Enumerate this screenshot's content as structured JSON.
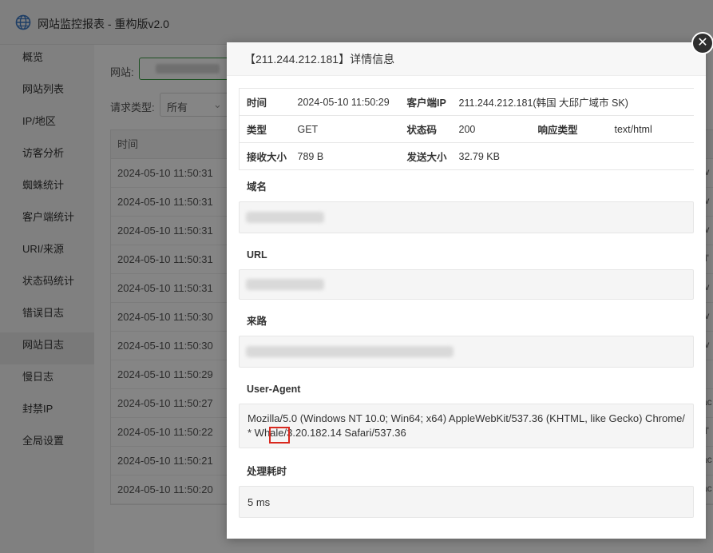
{
  "window": {
    "title": "网站监控报表 - 重构版v2.0",
    "logo_icon": "globe-icon"
  },
  "sidebar": {
    "items": [
      {
        "label": "概览",
        "active": false
      },
      {
        "label": "网站列表",
        "active": false
      },
      {
        "label": "IP/地区",
        "active": false
      },
      {
        "label": "访客分析",
        "active": false
      },
      {
        "label": "蜘蛛统计",
        "active": false
      },
      {
        "label": "客户端统计",
        "active": false
      },
      {
        "label": "URI/来源",
        "active": false
      },
      {
        "label": "状态码统计",
        "active": false
      },
      {
        "label": "错误日志",
        "active": false
      },
      {
        "label": "网站日志",
        "active": true
      },
      {
        "label": "慢日志",
        "active": false
      },
      {
        "label": "封禁IP",
        "active": false
      },
      {
        "label": "全局设置",
        "active": false
      }
    ]
  },
  "filters": {
    "site_label": "网站:",
    "request_type_label": "请求类型:",
    "request_type_value": "所有"
  },
  "log_table": {
    "header_time": "时间",
    "rows": [
      {
        "time": "2024-05-10 11:50:31",
        "tail": "/v"
      },
      {
        "time": "2024-05-10 11:50:31",
        "tail": "/v"
      },
      {
        "time": "2024-05-10 11:50:31",
        "tail": "/v"
      },
      {
        "time": "2024-05-10 11:50:31",
        "tail": "d'"
      },
      {
        "time": "2024-05-10 11:50:31",
        "tail": "/v"
      },
      {
        "time": "2024-05-10 11:50:30",
        "tail": "/v"
      },
      {
        "time": "2024-05-10 11:50:30",
        "tail": "/v"
      },
      {
        "time": "2024-05-10 11:50:29",
        "tail": "l"
      },
      {
        "time": "2024-05-10 11:50:27",
        "tail": "ac"
      },
      {
        "time": "2024-05-10 11:50:22",
        "tail": "d'"
      },
      {
        "time": "2024-05-10 11:50:21",
        "tail": "ac"
      },
      {
        "time": "2024-05-10 11:50:20",
        "tail": "ac"
      }
    ]
  },
  "modal": {
    "title": "【211.244.212.181】详情信息",
    "close_icon": "close-icon",
    "info": {
      "time_label": "时间",
      "time_value": "2024-05-10 11:50:29",
      "client_ip_label": "客户端IP",
      "client_ip_value": "211.244.212.181(韩国 大邱广域市 SK)",
      "type_label": "类型",
      "type_value": "GET",
      "status_label": "状态码",
      "status_value": "200",
      "resp_type_label": "响应类型",
      "resp_type_value": "text/html",
      "recv_label": "接收大小",
      "recv_value": "789 B",
      "sent_label": "发送大小",
      "sent_value": "32.79 KB"
    },
    "domain_label": "域名",
    "url_label": "URL",
    "referer_label": "来路",
    "ua_label": "User-Agent",
    "ua_value": "Mozilla/5.0 (Windows NT 10.0; Win64; x64) AppleWebKit/537.36 (KHTML, like Gecko) Chrome/* Whale/3.20.182.14 Safari/537.36",
    "elapsed_label": "处理耗时",
    "elapsed_value": "5 ms"
  }
}
